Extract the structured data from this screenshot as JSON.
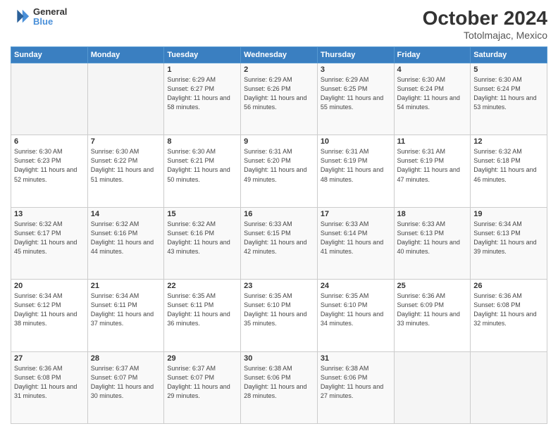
{
  "header": {
    "logo": {
      "line1": "General",
      "line2": "Blue"
    },
    "title": "October 2024",
    "subtitle": "Totolmajac, Mexico"
  },
  "weekdays": [
    "Sunday",
    "Monday",
    "Tuesday",
    "Wednesday",
    "Thursday",
    "Friday",
    "Saturday"
  ],
  "weeks": [
    [
      {
        "day": "",
        "info": ""
      },
      {
        "day": "",
        "info": ""
      },
      {
        "day": "1",
        "info": "Sunrise: 6:29 AM\nSunset: 6:27 PM\nDaylight: 11 hours and 58 minutes."
      },
      {
        "day": "2",
        "info": "Sunrise: 6:29 AM\nSunset: 6:26 PM\nDaylight: 11 hours and 56 minutes."
      },
      {
        "day": "3",
        "info": "Sunrise: 6:29 AM\nSunset: 6:25 PM\nDaylight: 11 hours and 55 minutes."
      },
      {
        "day": "4",
        "info": "Sunrise: 6:30 AM\nSunset: 6:24 PM\nDaylight: 11 hours and 54 minutes."
      },
      {
        "day": "5",
        "info": "Sunrise: 6:30 AM\nSunset: 6:24 PM\nDaylight: 11 hours and 53 minutes."
      }
    ],
    [
      {
        "day": "6",
        "info": "Sunrise: 6:30 AM\nSunset: 6:23 PM\nDaylight: 11 hours and 52 minutes."
      },
      {
        "day": "7",
        "info": "Sunrise: 6:30 AM\nSunset: 6:22 PM\nDaylight: 11 hours and 51 minutes."
      },
      {
        "day": "8",
        "info": "Sunrise: 6:30 AM\nSunset: 6:21 PM\nDaylight: 11 hours and 50 minutes."
      },
      {
        "day": "9",
        "info": "Sunrise: 6:31 AM\nSunset: 6:20 PM\nDaylight: 11 hours and 49 minutes."
      },
      {
        "day": "10",
        "info": "Sunrise: 6:31 AM\nSunset: 6:19 PM\nDaylight: 11 hours and 48 minutes."
      },
      {
        "day": "11",
        "info": "Sunrise: 6:31 AM\nSunset: 6:19 PM\nDaylight: 11 hours and 47 minutes."
      },
      {
        "day": "12",
        "info": "Sunrise: 6:32 AM\nSunset: 6:18 PM\nDaylight: 11 hours and 46 minutes."
      }
    ],
    [
      {
        "day": "13",
        "info": "Sunrise: 6:32 AM\nSunset: 6:17 PM\nDaylight: 11 hours and 45 minutes."
      },
      {
        "day": "14",
        "info": "Sunrise: 6:32 AM\nSunset: 6:16 PM\nDaylight: 11 hours and 44 minutes."
      },
      {
        "day": "15",
        "info": "Sunrise: 6:32 AM\nSunset: 6:16 PM\nDaylight: 11 hours and 43 minutes."
      },
      {
        "day": "16",
        "info": "Sunrise: 6:33 AM\nSunset: 6:15 PM\nDaylight: 11 hours and 42 minutes."
      },
      {
        "day": "17",
        "info": "Sunrise: 6:33 AM\nSunset: 6:14 PM\nDaylight: 11 hours and 41 minutes."
      },
      {
        "day": "18",
        "info": "Sunrise: 6:33 AM\nSunset: 6:13 PM\nDaylight: 11 hours and 40 minutes."
      },
      {
        "day": "19",
        "info": "Sunrise: 6:34 AM\nSunset: 6:13 PM\nDaylight: 11 hours and 39 minutes."
      }
    ],
    [
      {
        "day": "20",
        "info": "Sunrise: 6:34 AM\nSunset: 6:12 PM\nDaylight: 11 hours and 38 minutes."
      },
      {
        "day": "21",
        "info": "Sunrise: 6:34 AM\nSunset: 6:11 PM\nDaylight: 11 hours and 37 minutes."
      },
      {
        "day": "22",
        "info": "Sunrise: 6:35 AM\nSunset: 6:11 PM\nDaylight: 11 hours and 36 minutes."
      },
      {
        "day": "23",
        "info": "Sunrise: 6:35 AM\nSunset: 6:10 PM\nDaylight: 11 hours and 35 minutes."
      },
      {
        "day": "24",
        "info": "Sunrise: 6:35 AM\nSunset: 6:10 PM\nDaylight: 11 hours and 34 minutes."
      },
      {
        "day": "25",
        "info": "Sunrise: 6:36 AM\nSunset: 6:09 PM\nDaylight: 11 hours and 33 minutes."
      },
      {
        "day": "26",
        "info": "Sunrise: 6:36 AM\nSunset: 6:08 PM\nDaylight: 11 hours and 32 minutes."
      }
    ],
    [
      {
        "day": "27",
        "info": "Sunrise: 6:36 AM\nSunset: 6:08 PM\nDaylight: 11 hours and 31 minutes."
      },
      {
        "day": "28",
        "info": "Sunrise: 6:37 AM\nSunset: 6:07 PM\nDaylight: 11 hours and 30 minutes."
      },
      {
        "day": "29",
        "info": "Sunrise: 6:37 AM\nSunset: 6:07 PM\nDaylight: 11 hours and 29 minutes."
      },
      {
        "day": "30",
        "info": "Sunrise: 6:38 AM\nSunset: 6:06 PM\nDaylight: 11 hours and 28 minutes."
      },
      {
        "day": "31",
        "info": "Sunrise: 6:38 AM\nSunset: 6:06 PM\nDaylight: 11 hours and 27 minutes."
      },
      {
        "day": "",
        "info": ""
      },
      {
        "day": "",
        "info": ""
      }
    ]
  ]
}
